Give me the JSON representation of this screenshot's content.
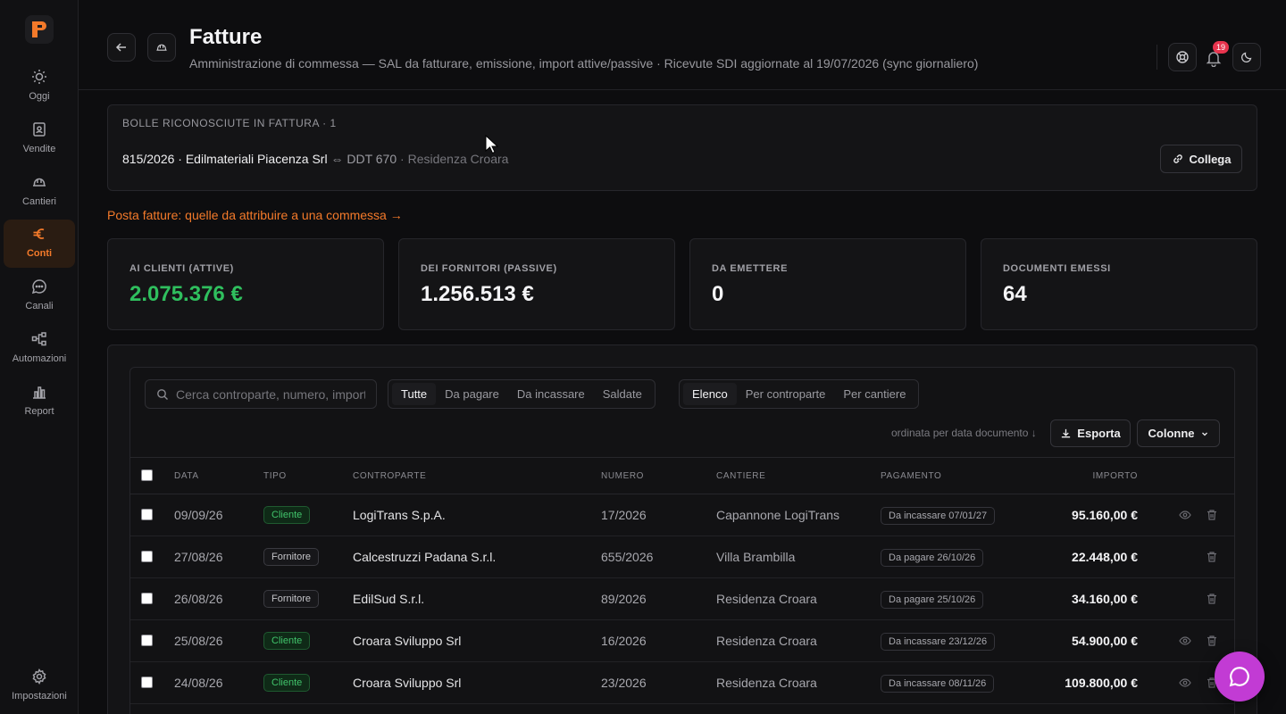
{
  "colors": {
    "accent": "#f47a2a",
    "positive": "#2fbf5e",
    "chat": "#c23bd4",
    "notification": "#e8344e"
  },
  "sidebar": {
    "items": [
      {
        "label": "Oggi",
        "icon": "sun-icon"
      },
      {
        "label": "Vendite",
        "icon": "contact-book-icon"
      },
      {
        "label": "Cantieri",
        "icon": "hard-hat-icon"
      },
      {
        "label": "Conti",
        "icon": "euro-icon",
        "active": true
      },
      {
        "label": "Canali",
        "icon": "chat-bubble-icon"
      },
      {
        "label": "Automazioni",
        "icon": "workflow-icon"
      },
      {
        "label": "Report",
        "icon": "bar-chart-icon"
      }
    ],
    "settings_label": "Impostazioni"
  },
  "header": {
    "title": "Fatture",
    "subtitle": "Amministrazione di commessa — SAL da fatturare, emissione, import attive/passive · Ricevute SDI aggiornate al 19/07/2026 (sync giornaliero)",
    "notifications_count": "19"
  },
  "bolle": {
    "title": "BOLLE RICONOSCIUTE IN FATTURA · 1",
    "invoice": "815/2026 · Edilmateriali Piacenza Srl",
    "arrow": "⇔",
    "ddt": "DDT 670",
    "sep": "·",
    "site": "Residenza Croara",
    "link_button": "Collega"
  },
  "posta_link": "Posta fatture: quelle da attribuire a una commessa →",
  "kpis": [
    {
      "label": "AI CLIENTI (ATTIVE)",
      "value": "2.075.376 €",
      "positive": true
    },
    {
      "label": "DEI FORNITORI (PASSIVE)",
      "value": "1.256.513 €"
    },
    {
      "label": "DA EMETTERE",
      "value": "0"
    },
    {
      "label": "DOCUMENTI EMESSI",
      "value": "64"
    }
  ],
  "toolbar": {
    "search_placeholder": "Cerca controparte, numero, importo",
    "filters": [
      "Tutte",
      "Da pagare",
      "Da incassare",
      "Saldate"
    ],
    "active_filter": "Tutte",
    "views": [
      "Elenco",
      "Per controparte",
      "Per cantiere"
    ],
    "active_view": "Elenco",
    "sort_note": "ordinata per data documento ↓",
    "export_label": "Esporta",
    "columns_label": "Colonne"
  },
  "table": {
    "headers": [
      "DATA",
      "TIPO",
      "CONTROPARTE",
      "NUMERO",
      "CANTIERE",
      "PAGAMENTO",
      "IMPORTO"
    ],
    "rows": [
      {
        "date": "09/09/26",
        "type": "Cliente",
        "party": "LogiTrans S.p.A.",
        "number": "17/2026",
        "site": "Capannone LogiTrans",
        "payment": "Da incassare 07/01/27",
        "amount": "95.160,00 €",
        "view": true
      },
      {
        "date": "27/08/26",
        "type": "Fornitore",
        "party": "Calcestruzzi Padana S.r.l.",
        "number": "655/2026",
        "site": "Villa Brambilla",
        "payment": "Da pagare 26/10/26",
        "amount": "22.448,00 €",
        "view": false
      },
      {
        "date": "26/08/26",
        "type": "Fornitore",
        "party": "EdilSud S.r.l.",
        "number": "89/2026",
        "site": "Residenza Croara",
        "payment": "Da pagare 25/10/26",
        "amount": "34.160,00 €",
        "view": false
      },
      {
        "date": "25/08/26",
        "type": "Cliente",
        "party": "Croara Sviluppo Srl",
        "number": "16/2026",
        "site": "Residenza Croara",
        "payment": "Da incassare 23/12/26",
        "amount": "54.900,00 €",
        "view": true
      },
      {
        "date": "24/08/26",
        "type": "Cliente",
        "party": "Croara Sviluppo Srl",
        "number": "23/2026",
        "site": "Residenza Croara",
        "payment": "Da incassare 08/11/26",
        "amount": "109.800,00 €",
        "view": true
      }
    ]
  }
}
